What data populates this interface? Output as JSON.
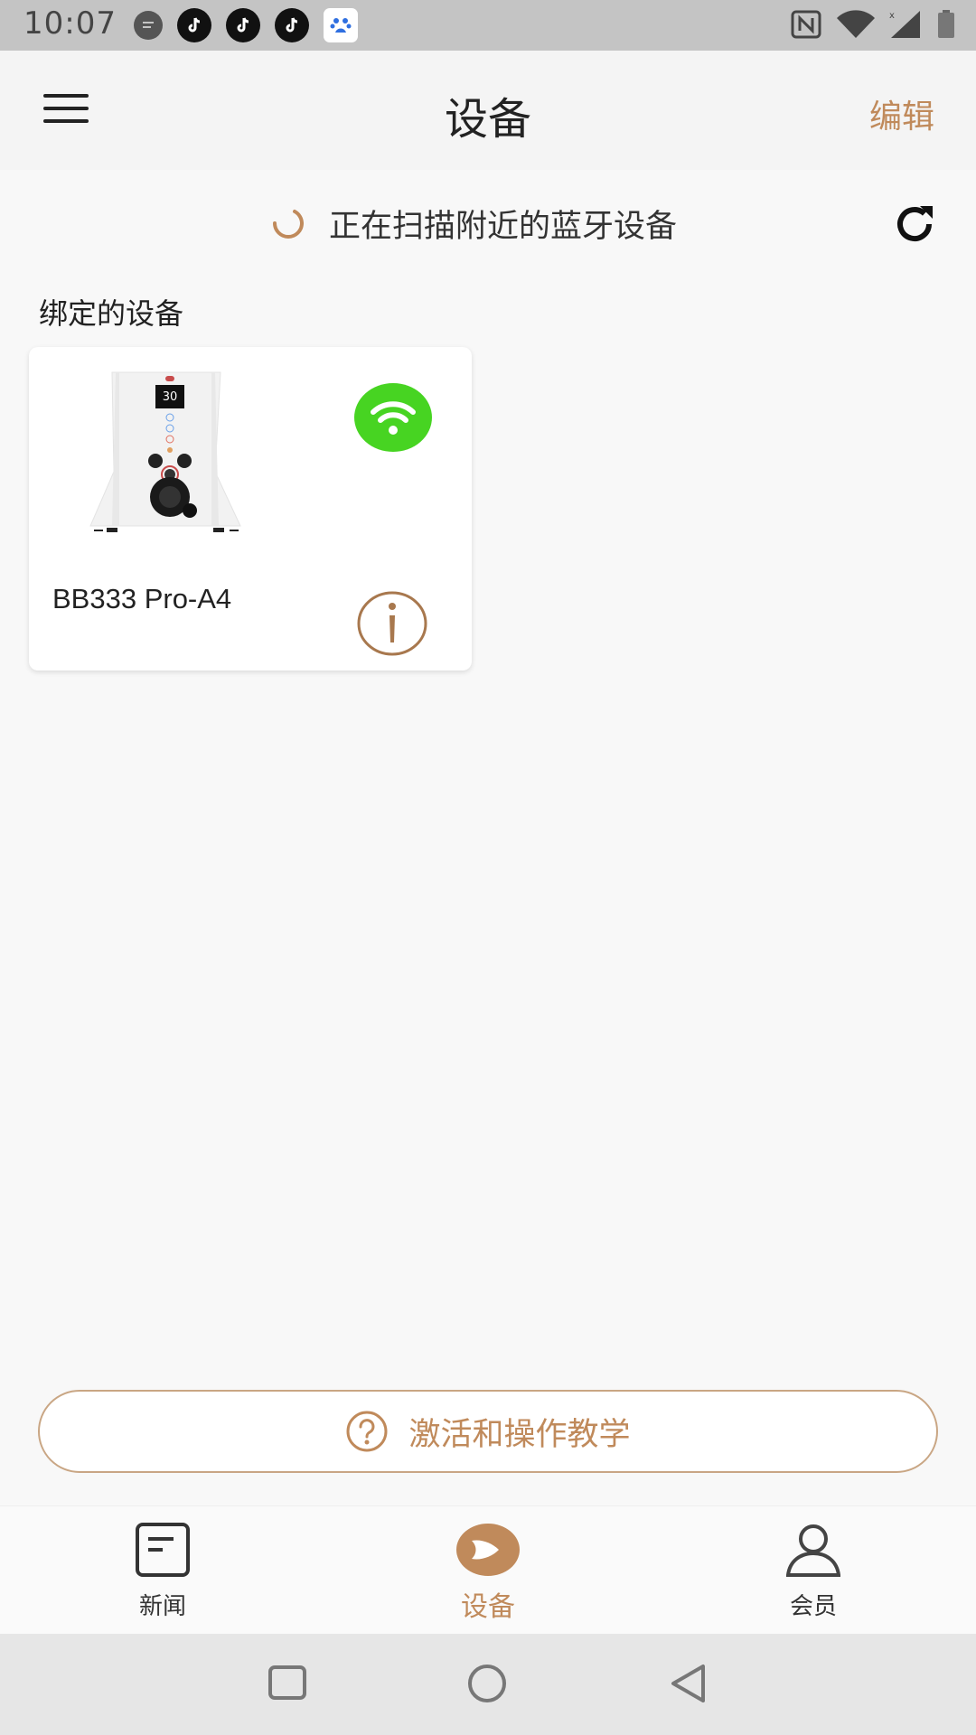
{
  "status_bar": {
    "time": "10:07",
    "left_icons": [
      "message-icon",
      "tiktok-icon",
      "tiktok-icon",
      "tiktok-icon",
      "baidu-icon"
    ],
    "right_icons": [
      "nfc-icon",
      "wifi-icon",
      "signal-icon",
      "battery-icon"
    ]
  },
  "header": {
    "title": "设备",
    "edit_label": "编辑"
  },
  "scan": {
    "text": "正在扫描附近的蓝牙设备"
  },
  "bound_devices": {
    "label": "绑定的设备",
    "items": [
      {
        "name": "BB333 Pro-A4",
        "status_icon": "wifi-icon",
        "status_color": "#47d422"
      }
    ]
  },
  "tutorial": {
    "label": "激活和操作教学"
  },
  "bottom_nav": {
    "items": [
      {
        "label": "新闻",
        "icon": "news-icon",
        "active": false
      },
      {
        "label": "设备",
        "icon": "device-icon",
        "active": true
      },
      {
        "label": "会员",
        "icon": "member-icon",
        "active": false
      }
    ]
  },
  "colors": {
    "accent": "#c08a5b",
    "online": "#47d422"
  }
}
